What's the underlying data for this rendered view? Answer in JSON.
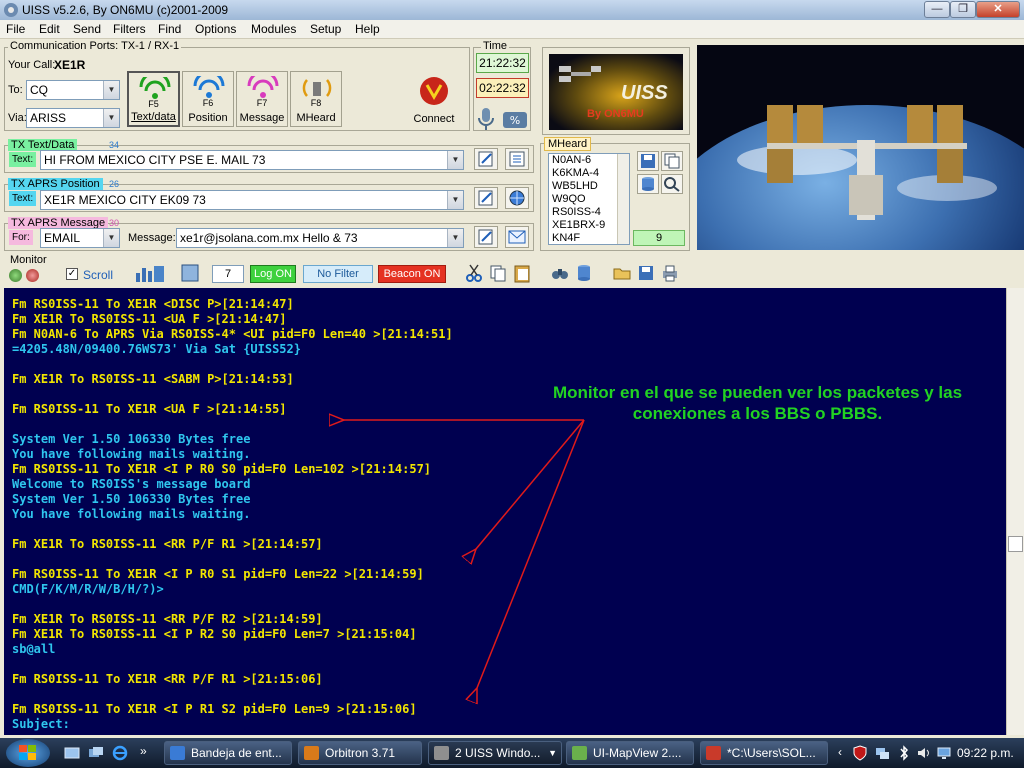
{
  "window": {
    "title": "UISS v5.2.6, By ON6MU (c)2001-2009",
    "minimize": "—",
    "maximize": "❐",
    "close": "✕"
  },
  "menu": [
    "File",
    "Edit",
    "Send",
    "Filters",
    "Find",
    "Options",
    "Modules",
    "Setup",
    "Help"
  ],
  "comm": {
    "group_label": "Communication Ports: TX-1 / RX-1",
    "your_call_label": "Your Call:",
    "your_call": "XE1R",
    "to_label": "To:",
    "to_value": "CQ",
    "via_label": "Via:",
    "via_value": "ARISS"
  },
  "mode_buttons": [
    {
      "key": "F5",
      "label": "Text/data"
    },
    {
      "key": "F6",
      "label": "Position"
    },
    {
      "key": "F7",
      "label": "Message"
    },
    {
      "key": "F8",
      "label": "MHeard"
    }
  ],
  "connect_label": "Connect",
  "time": {
    "label": "Time",
    "local": "21:22:32",
    "utc": "02:22:32"
  },
  "logo_text": "UISS",
  "logo_by": "By ON6MU",
  "tx_text": {
    "label": "TX Text/Data",
    "count": "34",
    "field_label": "Text:",
    "value": "HI FROM MEXICO CITY PSE E. MAIL 73"
  },
  "tx_pos": {
    "label": "TX APRS Position",
    "count": "26",
    "field_label": "Text:",
    "value": "XE1R   MEXICO CITY EK09 73"
  },
  "tx_msg": {
    "label": "TX APRS Message",
    "count": "30",
    "for_label": "For:",
    "for_value": "EMAIL",
    "message_label": "Message:",
    "message_value": "xe1r@jsolana.com.mx Hello & 73"
  },
  "mheard": {
    "label": "MHeard",
    "stations": [
      "N0AN-6",
      "K6KMA-4",
      "WB5LHD",
      "W9QO",
      "RS0ISS-4",
      "XE1BRX-9",
      "KN4F"
    ],
    "count": "9"
  },
  "monitor": {
    "label": "Monitor",
    "scroll_label": "Scroll",
    "counter": "7",
    "log_on": "Log ON",
    "no_filter": "No Filter",
    "beacon_on": "Beacon ON",
    "lines": [
      {
        "t": "Fm RS0ISS-11 To XE1R <DISC P>[21:14:47]",
        "c": "y"
      },
      {
        "t": "Fm XE1R To RS0ISS-11 <UA F >[21:14:47]",
        "c": "y"
      },
      {
        "t": "Fm N0AN-6 To APRS Via RS0ISS-4* <UI pid=F0 Len=40 >[21:14:51]",
        "c": "y"
      },
      {
        "t": "=4205.48N/09400.76WS73' Via Sat {UISS52}",
        "c": "c"
      },
      {
        "t": "",
        "c": "y"
      },
      {
        "t": "Fm XE1R To RS0ISS-11 <SABM P>[21:14:53]",
        "c": "y"
      },
      {
        "t": "",
        "c": "y"
      },
      {
        "t": "Fm RS0ISS-11 To XE1R <UA F >[21:14:55]",
        "c": "y"
      },
      {
        "t": "",
        "c": "y"
      },
      {
        "t": "System Ver 1.50 106330 Bytes free",
        "c": "c"
      },
      {
        "t": "You have following mails waiting.",
        "c": "c"
      },
      {
        "t": "Fm RS0ISS-11 To XE1R <I P R0 S0 pid=F0 Len=102 >[21:14:57]",
        "c": "y"
      },
      {
        "t": "Welcome to RS0ISS's message board",
        "c": "c"
      },
      {
        "t": "System Ver 1.50 106330 Bytes free",
        "c": "c"
      },
      {
        "t": "You have following mails waiting.",
        "c": "c"
      },
      {
        "t": "",
        "c": "y"
      },
      {
        "t": "Fm XE1R To RS0ISS-11 <RR P/F R1 >[21:14:57]",
        "c": "y"
      },
      {
        "t": "",
        "c": "y"
      },
      {
        "t": "Fm RS0ISS-11 To XE1R <I P R0 S1 pid=F0 Len=22 >[21:14:59]",
        "c": "y"
      },
      {
        "t": "CMD(F/K/M/R/W/B/H/?)>",
        "c": "c"
      },
      {
        "t": "",
        "c": "y"
      },
      {
        "t": "Fm XE1R To RS0ISS-11 <RR P/F R2 >[21:14:59]",
        "c": "y"
      },
      {
        "t": "Fm XE1R To RS0ISS-11 <I P R2 S0 pid=F0 Len=7 >[21:15:04]",
        "c": "y"
      },
      {
        "t": "sb@all",
        "c": "c"
      },
      {
        "t": "",
        "c": "y"
      },
      {
        "t": "Fm RS0ISS-11 To XE1R <RR P/F R1 >[21:15:06]",
        "c": "y"
      },
      {
        "t": "",
        "c": "y"
      },
      {
        "t": "Fm RS0ISS-11 To XE1R <I P R1 S2 pid=F0 Len=9 >[21:15:06]",
        "c": "y"
      },
      {
        "t": "Subject:",
        "c": "c"
      }
    ]
  },
  "annotation": "Monitor en el que se pueden ver los packetes y las conexiones a los BBS o PBBS.",
  "colors": {
    "yellow": "#f2e600",
    "cyan": "#2fc6ee",
    "annotation": "#22d322",
    "arrow": "#e01a1a"
  },
  "taskbar": {
    "tasks": [
      "Bandeja de ent...",
      "Orbitron 3.71",
      "2 UISS Windo...",
      "UI-MapView 2....",
      "*C:\\Users\\SOL..."
    ],
    "clock": "09:22 p.m."
  }
}
